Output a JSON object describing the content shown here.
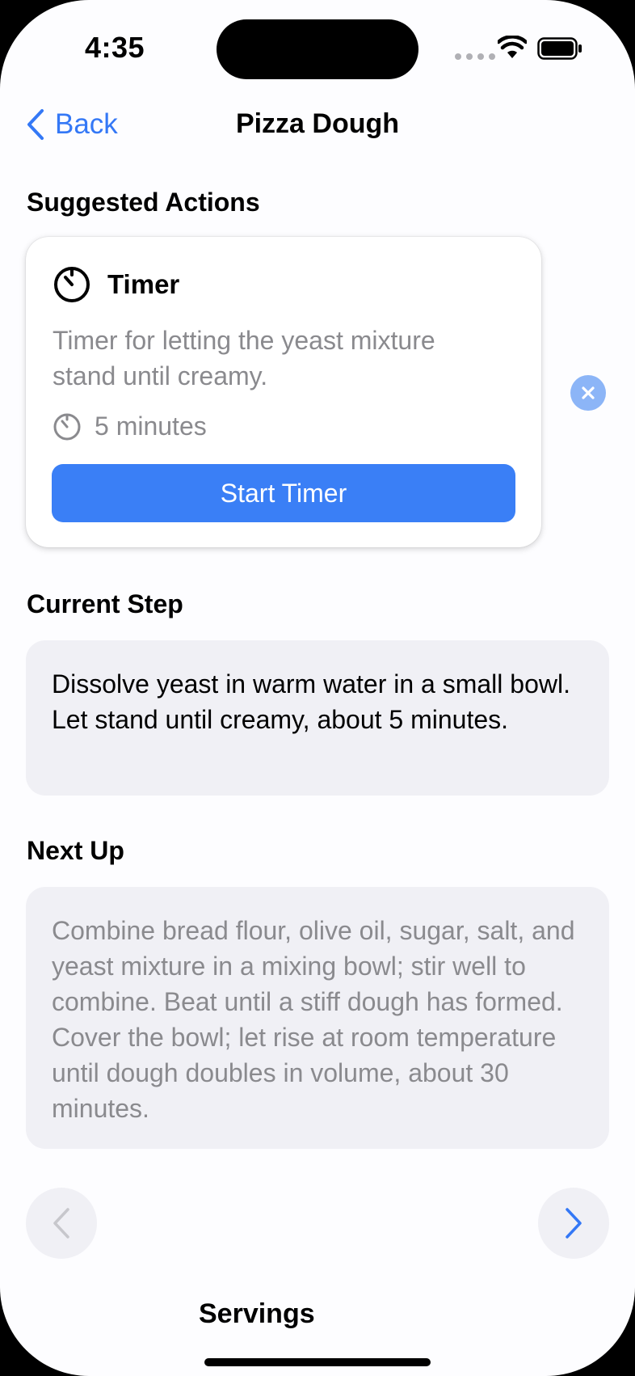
{
  "status_bar": {
    "time": "4:35"
  },
  "nav": {
    "back_label": "Back",
    "title": "Pizza Dough"
  },
  "suggested_actions": {
    "heading": "Suggested Actions",
    "timer_card": {
      "title": "Timer",
      "description": "Timer for letting the yeast mixture stand until creamy.",
      "duration": "5 minutes",
      "button_label": "Start Timer",
      "icon": "timer-icon"
    }
  },
  "current_step": {
    "heading": "Current Step",
    "text": "Dissolve yeast in warm water in a small bowl. Let stand until creamy, about 5 minutes."
  },
  "next_up": {
    "heading": "Next Up",
    "text": "Combine bread flour, olive oil, sugar, salt, and yeast mixture in a mixing bowl; stir well to combine. Beat until a stiff dough has formed. Cover the bowl; let rise at room temperature until dough doubles in volume, about 30 minutes."
  },
  "servings": {
    "label": "Servings"
  },
  "colors": {
    "accent": "#3478f6",
    "button": "#3a7ff6",
    "dismiss": "#8cb5f7",
    "box_background": "#f0f0f5",
    "secondary_text": "#8a8a8e"
  }
}
